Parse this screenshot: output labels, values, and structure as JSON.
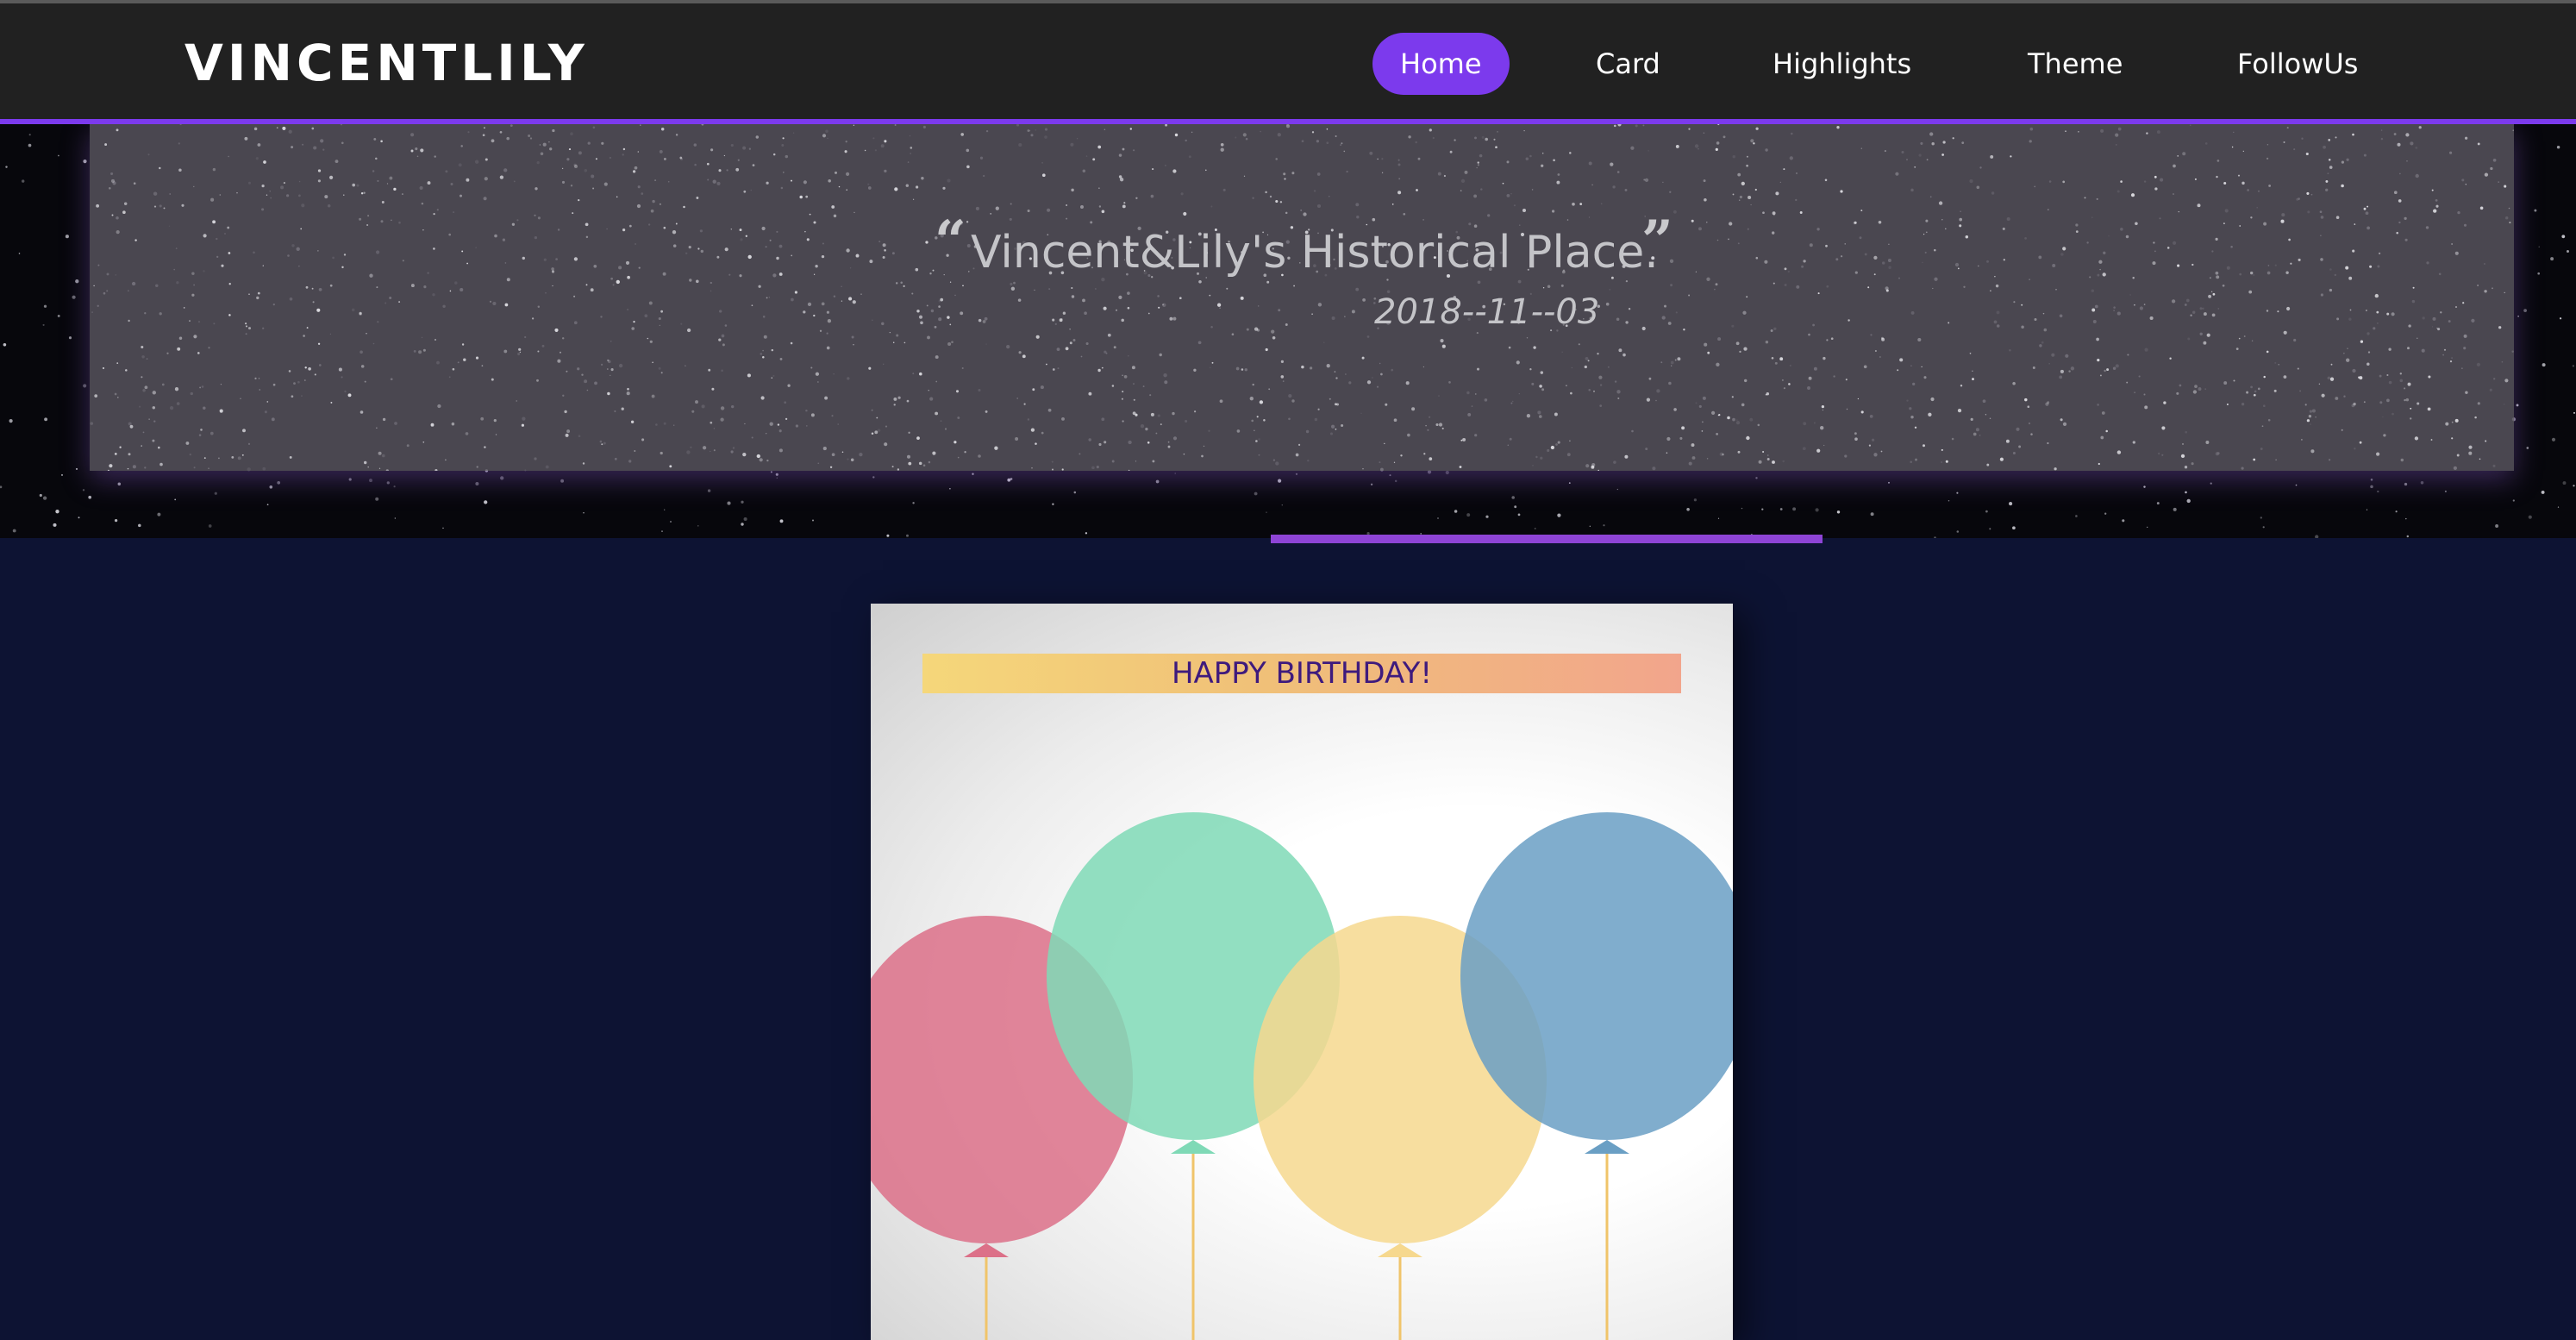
{
  "header": {
    "brand": "VINCENTLILY",
    "nav": [
      {
        "label": "Home",
        "active": true
      },
      {
        "label": "Card",
        "active": false
      },
      {
        "label": "Highlights",
        "active": false
      },
      {
        "label": "Theme",
        "active": false
      },
      {
        "label": "FollowUs",
        "active": false
      }
    ]
  },
  "hero": {
    "quote": "Vincent&Lily's Historical Place.",
    "open_mark": "“",
    "close_mark": "”",
    "date": "2018--11--03"
  },
  "card": {
    "banner": "HAPPY BIRTHDAY!",
    "balloon_colors": [
      "#dc7088",
      "#7fd9b6",
      "#f6d88e",
      "#6a9fc4"
    ]
  },
  "colors": {
    "accent": "#7c3aed",
    "background": "#0d1333",
    "topbar": "#212121"
  }
}
